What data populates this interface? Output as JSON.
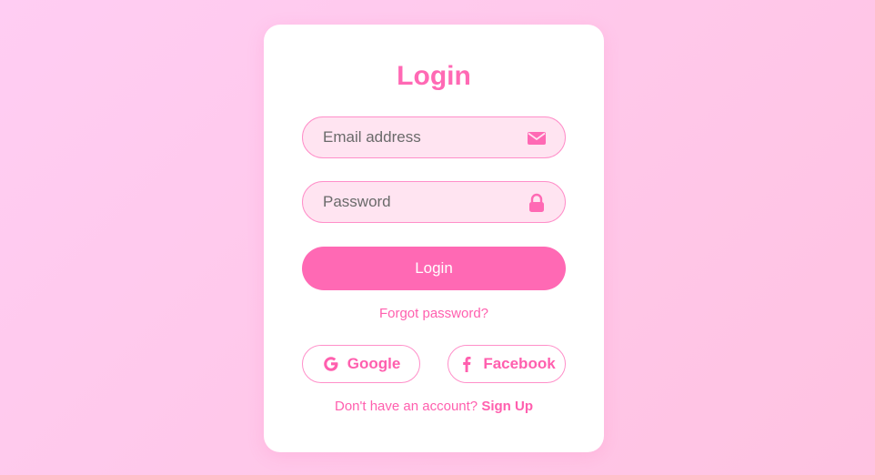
{
  "login_card": {
    "title": "Login",
    "email_field": {
      "placeholder": "Email address",
      "value": "",
      "icon": "envelope-icon"
    },
    "password_field": {
      "placeholder": "Password",
      "value": "",
      "icon": "lock-icon"
    },
    "login_button_label": "Login",
    "forgot_password_link": "Forgot password?",
    "social_buttons": [
      {
        "label": "Google",
        "icon": "google-icon"
      },
      {
        "label": "Facebook",
        "icon": "facebook-icon"
      }
    ],
    "signup_prompt": "Don't have an account?",
    "signup_link": "Sign Up"
  },
  "colors": {
    "accent": "#ff69b4",
    "link": "#ff5fae",
    "field_background": "#ffe4f1",
    "field_border": "#ff8fc9",
    "card_background": "#ffffff",
    "page_background": "#ffc8ea"
  }
}
